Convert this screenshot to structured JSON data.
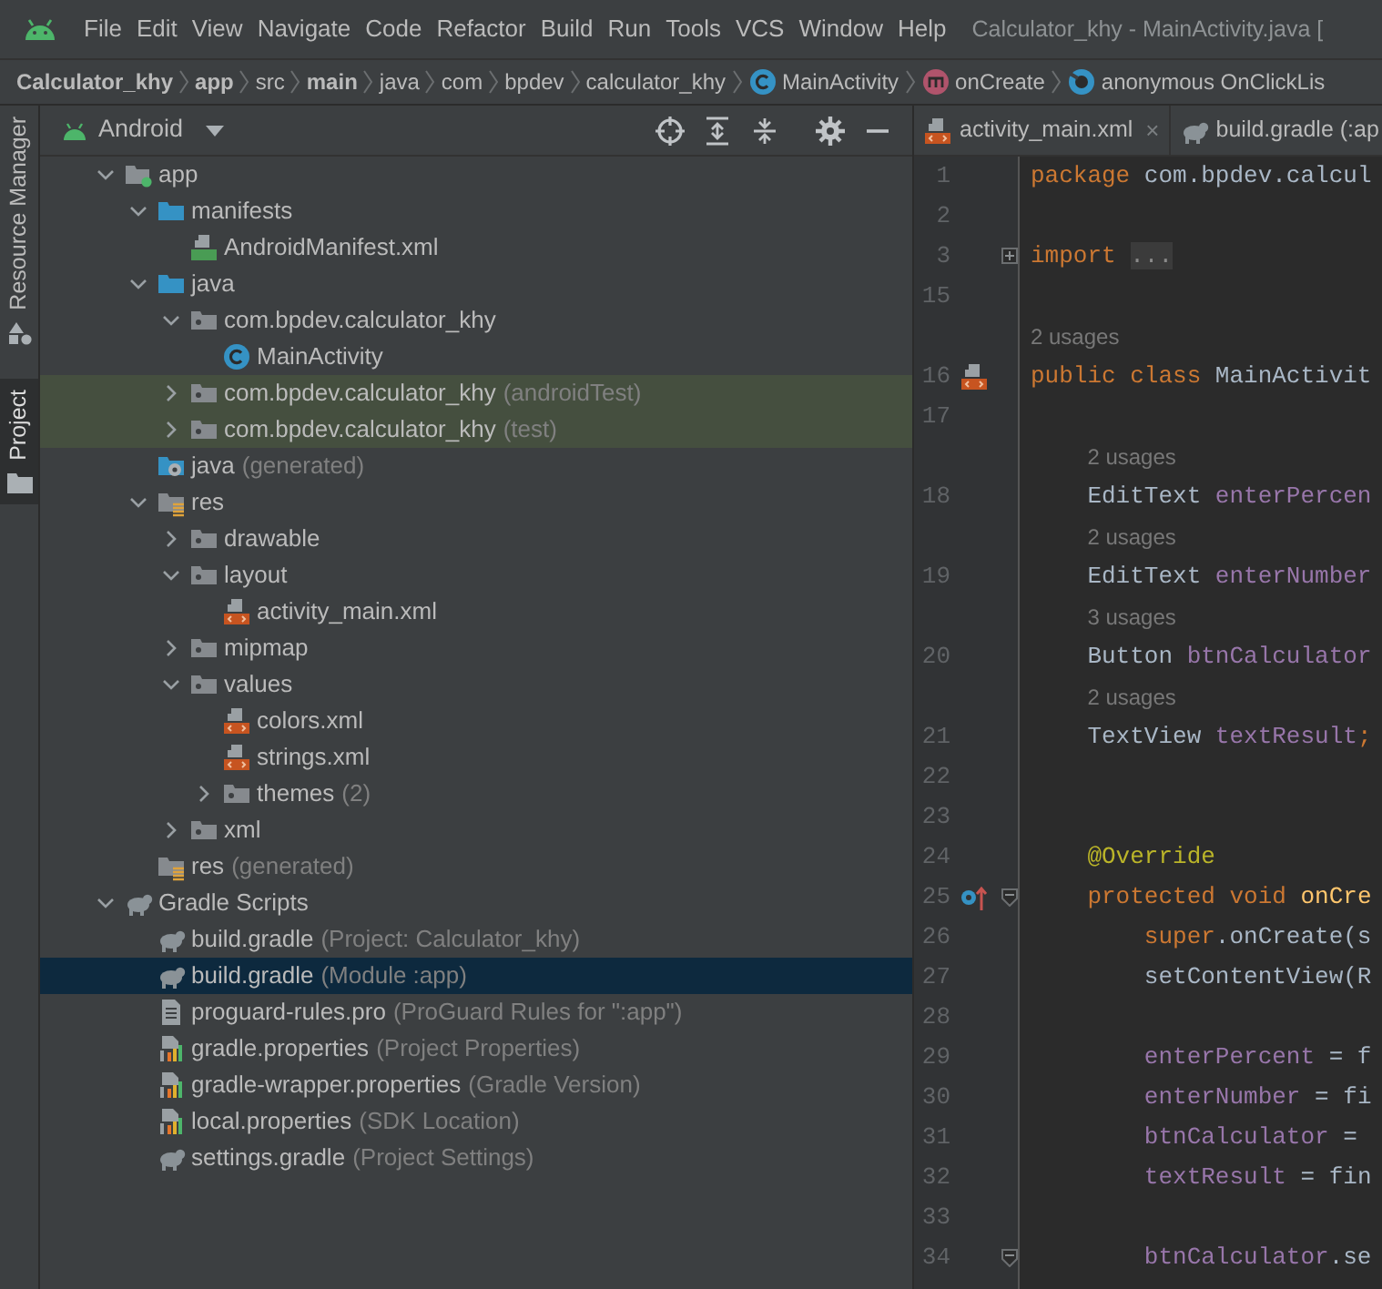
{
  "menu": {
    "items": [
      "File",
      "Edit",
      "View",
      "Navigate",
      "Code",
      "Refactor",
      "Build",
      "Run",
      "Tools",
      "VCS",
      "Window",
      "Help"
    ],
    "title": "Calculator_khy - MainActivity.java ["
  },
  "breadcrumb": [
    {
      "label": "Calculator_khy",
      "bold": true,
      "kind": "path"
    },
    {
      "label": "app",
      "bold": true,
      "kind": "path"
    },
    {
      "label": "src",
      "bold": false,
      "kind": "path"
    },
    {
      "label": "main",
      "bold": true,
      "kind": "path"
    },
    {
      "label": "java",
      "bold": false,
      "kind": "path"
    },
    {
      "label": "com",
      "bold": false,
      "kind": "path"
    },
    {
      "label": "bpdev",
      "bold": false,
      "kind": "path"
    },
    {
      "label": "calculator_khy",
      "bold": false,
      "kind": "path"
    },
    {
      "label": "MainActivity",
      "bold": false,
      "kind": "class"
    },
    {
      "label": "onCreate",
      "bold": false,
      "kind": "method"
    },
    {
      "label": "anonymous OnClickLis",
      "bold": false,
      "kind": "anonymous"
    }
  ],
  "side_tabs": [
    {
      "label": "Resource Manager",
      "selected": false,
      "kind": "resources"
    },
    {
      "label": "Project",
      "selected": true,
      "kind": "project"
    }
  ],
  "project_panel": {
    "view": "Android",
    "tree": [
      {
        "label": "app",
        "kind": "module",
        "expanded": true,
        "selected": false,
        "highlighted": false,
        "children": [
          {
            "label": "manifests",
            "kind": "source",
            "expanded": true,
            "selected": false,
            "highlighted": false,
            "children": [
              {
                "label": "AndroidManifest.xml",
                "kind": "manifest",
                "selected": false,
                "highlighted": false
              }
            ]
          },
          {
            "label": "java",
            "kind": "source",
            "expanded": true,
            "selected": false,
            "highlighted": false,
            "children": [
              {
                "label": "com.bpdev.calculator_khy",
                "kind": "package",
                "expanded": true,
                "selected": false,
                "highlighted": false,
                "children": [
                  {
                    "label": "MainActivity",
                    "kind": "class",
                    "selected": false,
                    "highlighted": false
                  }
                ]
              },
              {
                "label": "com.bpdev.calculator_khy",
                "note": "(androidTest)",
                "kind": "package",
                "expanded": false,
                "selected": false,
                "highlighted": true
              },
              {
                "label": "com.bpdev.calculator_khy",
                "note": "(test)",
                "kind": "package",
                "expanded": false,
                "selected": false,
                "highlighted": true
              }
            ]
          },
          {
            "label": "java",
            "note": "(generated)",
            "kind": "generated",
            "selected": false,
            "highlighted": false
          },
          {
            "label": "res",
            "kind": "res",
            "expanded": true,
            "selected": false,
            "highlighted": false,
            "children": [
              {
                "label": "drawable",
                "kind": "package",
                "expanded": false,
                "selected": false,
                "highlighted": false
              },
              {
                "label": "layout",
                "kind": "package",
                "expanded": true,
                "selected": false,
                "highlighted": false,
                "children": [
                  {
                    "label": "activity_main.xml",
                    "kind": "xml",
                    "selected": false,
                    "highlighted": false
                  }
                ]
              },
              {
                "label": "mipmap",
                "kind": "package",
                "expanded": false,
                "selected": false,
                "highlighted": false
              },
              {
                "label": "values",
                "kind": "package",
                "expanded": true,
                "selected": false,
                "highlighted": false,
                "children": [
                  {
                    "label": "colors.xml",
                    "kind": "xml",
                    "selected": false,
                    "highlighted": false
                  },
                  {
                    "label": "strings.xml",
                    "kind": "xml",
                    "selected": false,
                    "highlighted": false
                  },
                  {
                    "label": "themes",
                    "note": "(2)",
                    "kind": "package",
                    "expanded": false,
                    "selected": false,
                    "highlighted": false
                  }
                ]
              },
              {
                "label": "xml",
                "kind": "package",
                "expanded": false,
                "selected": false,
                "highlighted": false
              }
            ]
          },
          {
            "label": "res",
            "note": "(generated)",
            "kind": "res",
            "selected": false,
            "highlighted": false
          }
        ]
      },
      {
        "label": "Gradle Scripts",
        "kind": "gradle",
        "expanded": true,
        "selected": false,
        "highlighted": false,
        "children": [
          {
            "label": "build.gradle",
            "note": "(Project: Calculator_khy)",
            "kind": "gradle",
            "selected": false,
            "highlighted": false
          },
          {
            "label": "build.gradle",
            "note": "(Module :app)",
            "kind": "gradle",
            "selected": true,
            "highlighted": false
          },
          {
            "label": "proguard-rules.pro",
            "note": "(ProGuard Rules for \":app\")",
            "kind": "text",
            "selected": false,
            "highlighted": false
          },
          {
            "label": "gradle.properties",
            "note": "(Project Properties)",
            "kind": "properties",
            "selected": false,
            "highlighted": false
          },
          {
            "label": "gradle-wrapper.properties",
            "note": "(Gradle Version)",
            "kind": "properties",
            "selected": false,
            "highlighted": false
          },
          {
            "label": "local.properties",
            "note": "(SDK Location)",
            "kind": "properties",
            "selected": false,
            "highlighted": false
          },
          {
            "label": "settings.gradle",
            "note": "(Project Settings)",
            "kind": "gradle",
            "selected": false,
            "highlighted": false
          }
        ]
      }
    ]
  },
  "editor_tabs": [
    {
      "label": "activity_main.xml",
      "kind": "xml",
      "close": "×"
    },
    {
      "label": "build.gradle (:ap",
      "kind": "gradle"
    }
  ],
  "editor_lines": [
    {
      "number": "1",
      "kind": "plain",
      "tokens": [
        {
          "kind": "keyword",
          "text": "package "
        },
        {
          "kind": "plain",
          "text": "com.bpdev.calcul"
        }
      ]
    },
    {
      "number": "2",
      "kind": "plain"
    },
    {
      "number": "3",
      "kind": "import",
      "tokens": [
        {
          "kind": "keyword",
          "text": "import "
        },
        {
          "kind": "folded",
          "text": "..."
        }
      ]
    },
    {
      "number": "15",
      "kind": "plain"
    },
    {
      "number": "16",
      "kind": "class",
      "usages": "2 usages",
      "tokens": [
        {
          "kind": "keyword",
          "text": "public class "
        },
        {
          "kind": "plain",
          "text": "MainActivit"
        }
      ]
    },
    {
      "number": "17",
      "kind": "plain"
    },
    {
      "number": "18",
      "kind": "plain",
      "usages": "2 usages",
      "tokens": [
        {
          "kind": "plain",
          "text": "    EditText "
        },
        {
          "kind": "field",
          "text": "enterPercen"
        }
      ]
    },
    {
      "number": "19",
      "kind": "plain",
      "usages": "2 usages",
      "tokens": [
        {
          "kind": "plain",
          "text": "    EditText "
        },
        {
          "kind": "field",
          "text": "enterNumber"
        }
      ]
    },
    {
      "number": "20",
      "kind": "plain",
      "usages": "3 usages",
      "tokens": [
        {
          "kind": "plain",
          "text": "    Button "
        },
        {
          "kind": "field",
          "text": "btnCalculator"
        }
      ]
    },
    {
      "number": "21",
      "kind": "plain",
      "usages": "2 usages",
      "tokens": [
        {
          "kind": "plain",
          "text": "    TextView "
        },
        {
          "kind": "field",
          "text": "textResult"
        },
        {
          "kind": "keyword",
          "text": ";"
        }
      ]
    },
    {
      "number": "22",
      "kind": "plain"
    },
    {
      "number": "23",
      "kind": "plain"
    },
    {
      "number": "24",
      "kind": "plain",
      "tokens": [
        {
          "kind": "annotation",
          "text": "    @Override"
        }
      ]
    },
    {
      "number": "25",
      "kind": "method",
      "tokens": [
        {
          "kind": "keyword",
          "text": "    protected void "
        },
        {
          "kind": "method",
          "text": "onCre"
        }
      ]
    },
    {
      "number": "26",
      "kind": "plain",
      "tokens": [
        {
          "kind": "keyword",
          "text": "        super"
        },
        {
          "kind": "plain",
          "text": ".onCreate(s"
        }
      ]
    },
    {
      "number": "27",
      "kind": "plain",
      "tokens": [
        {
          "kind": "plain",
          "text": "        setContentView(R"
        }
      ]
    },
    {
      "number": "28",
      "kind": "plain"
    },
    {
      "number": "29",
      "kind": "plain",
      "tokens": [
        {
          "kind": "field",
          "text": "        enterPercent"
        },
        {
          "kind": "plain",
          "text": " = f"
        }
      ]
    },
    {
      "number": "30",
      "kind": "plain",
      "tokens": [
        {
          "kind": "field",
          "text": "        enterNumber"
        },
        {
          "kind": "plain",
          "text": " = fi"
        }
      ]
    },
    {
      "number": "31",
      "kind": "plain",
      "tokens": [
        {
          "kind": "field",
          "text": "        btnCalculator"
        },
        {
          "kind": "plain",
          "text": " ="
        }
      ]
    },
    {
      "number": "32",
      "kind": "plain",
      "tokens": [
        {
          "kind": "field",
          "text": "        textResult"
        },
        {
          "kind": "plain",
          "text": " = fin"
        }
      ]
    },
    {
      "number": "33",
      "kind": "plain"
    },
    {
      "number": "34",
      "kind": "block",
      "tokens": [
        {
          "kind": "field",
          "text": "        btnCalculator"
        },
        {
          "kind": "plain",
          "text": ".se"
        }
      ]
    }
  ]
}
